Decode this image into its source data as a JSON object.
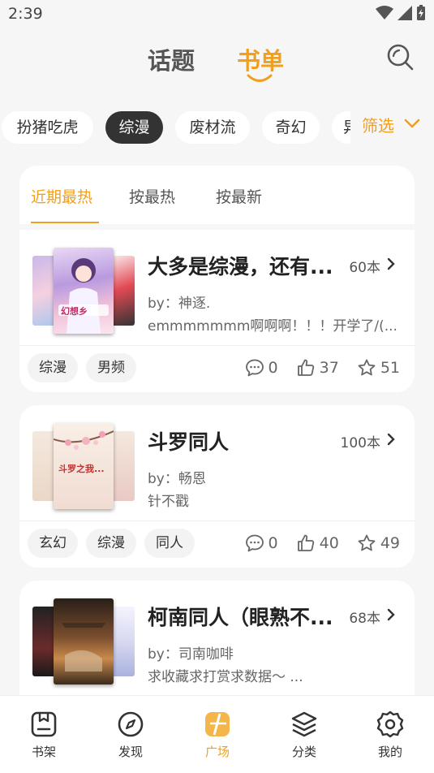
{
  "status_bar": {
    "time": "2:39"
  },
  "top_tabs": {
    "topic": "话题",
    "booklist": "书单"
  },
  "filter_chips": [
    "扮猪吃虎",
    "综漫",
    "废材流",
    "奇幻",
    "异"
  ],
  "filter_button": "筛选",
  "sort_tabs": [
    "近期最热",
    "按最热",
    "按最新"
  ],
  "booklists": [
    {
      "title": "大多是综漫，还有...",
      "count": "60本",
      "author": "by：神逐.",
      "desc": "emmmmmmm啊啊啊！！！开学了/(...",
      "tags": [
        "综漫",
        "男频"
      ],
      "comments": "0",
      "likes": "37",
      "stars": "51",
      "cover_text": "幻想乡"
    },
    {
      "title": "斗罗同人",
      "count": "100本",
      "author": "by：畅恩",
      "desc": "针不戳",
      "tags": [
        "玄幻",
        "综漫",
        "同人"
      ],
      "comments": "0",
      "likes": "40",
      "stars": "49",
      "cover_text": "斗罗之我..."
    },
    {
      "title": "柯南同人（眼熟不...",
      "count": "68本",
      "author": "by：司南咖啡",
      "desc": "求收藏求打赏求数据～ ..."
    }
  ],
  "bottom_nav": [
    "书架",
    "发现",
    "广场",
    "分类",
    "我的"
  ],
  "colors": {
    "accent": "#f0a020",
    "dark_chip": "#333333"
  }
}
